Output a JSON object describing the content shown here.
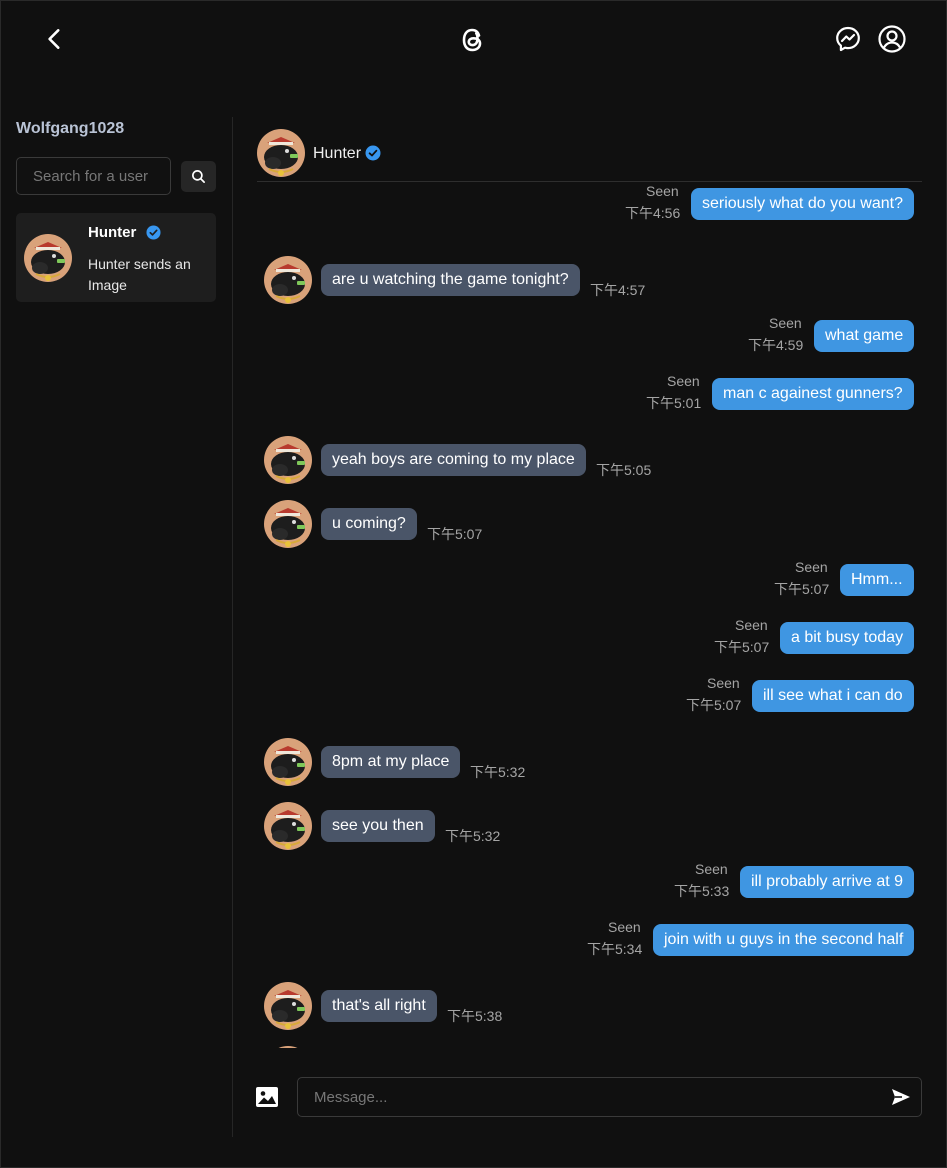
{
  "header": {
    "back_icon": "chevron-left-icon",
    "logo_icon": "threads-logo-icon",
    "messenger_icon": "messenger-icon",
    "profile_icon": "user-circle-icon"
  },
  "sidebar": {
    "username": "Wolfgang1028",
    "search": {
      "placeholder": "Search for a user"
    },
    "conversations": [
      {
        "name": "Hunter",
        "verified": true,
        "preview": "Hunter sends an Image"
      }
    ]
  },
  "chat": {
    "contact_name": "Hunter",
    "verified": true,
    "messages": [
      {
        "dir": "out",
        "text": "seriously what do you want?",
        "time": "下午4:56",
        "seen": "Seen"
      },
      {
        "dir": "in",
        "text": "are u watching the game tonight?",
        "time": "下午4:57"
      },
      {
        "dir": "out",
        "text": "what game",
        "time": "下午4:59",
        "seen": "Seen"
      },
      {
        "dir": "out",
        "text": "man c againest gunners?",
        "time": "下午5:01",
        "seen": "Seen"
      },
      {
        "dir": "in",
        "text": "yeah boys are coming to my place",
        "time": "下午5:05"
      },
      {
        "dir": "in",
        "text": "u coming?",
        "time": "下午5:07"
      },
      {
        "dir": "out",
        "text": "Hmm...",
        "time": "下午5:07",
        "seen": "Seen"
      },
      {
        "dir": "out",
        "text": "a bit busy today",
        "time": "下午5:07",
        "seen": "Seen"
      },
      {
        "dir": "out",
        "text": "ill see what i can do",
        "time": "下午5:07",
        "seen": "Seen"
      },
      {
        "dir": "in",
        "text": "8pm at my place",
        "time": "下午5:32"
      },
      {
        "dir": "in",
        "text": "see you then",
        "time": "下午5:32"
      },
      {
        "dir": "out",
        "text": "ill probably arrive at 9",
        "time": "下午5:33",
        "seen": "Seen"
      },
      {
        "dir": "out",
        "text": "join with u guys in the second half",
        "time": "下午5:34",
        "seen": "Seen"
      },
      {
        "dir": "in",
        "text": "that's all right",
        "time": "下午5:38"
      },
      {
        "dir": "in",
        "text": "",
        "time": ""
      }
    ],
    "input": {
      "placeholder": "Message..."
    }
  },
  "colors": {
    "background": "#101010",
    "incoming_bubble": "#4a5568",
    "outgoing_bubble": "#3f96e2",
    "verified": "#3897f0"
  }
}
